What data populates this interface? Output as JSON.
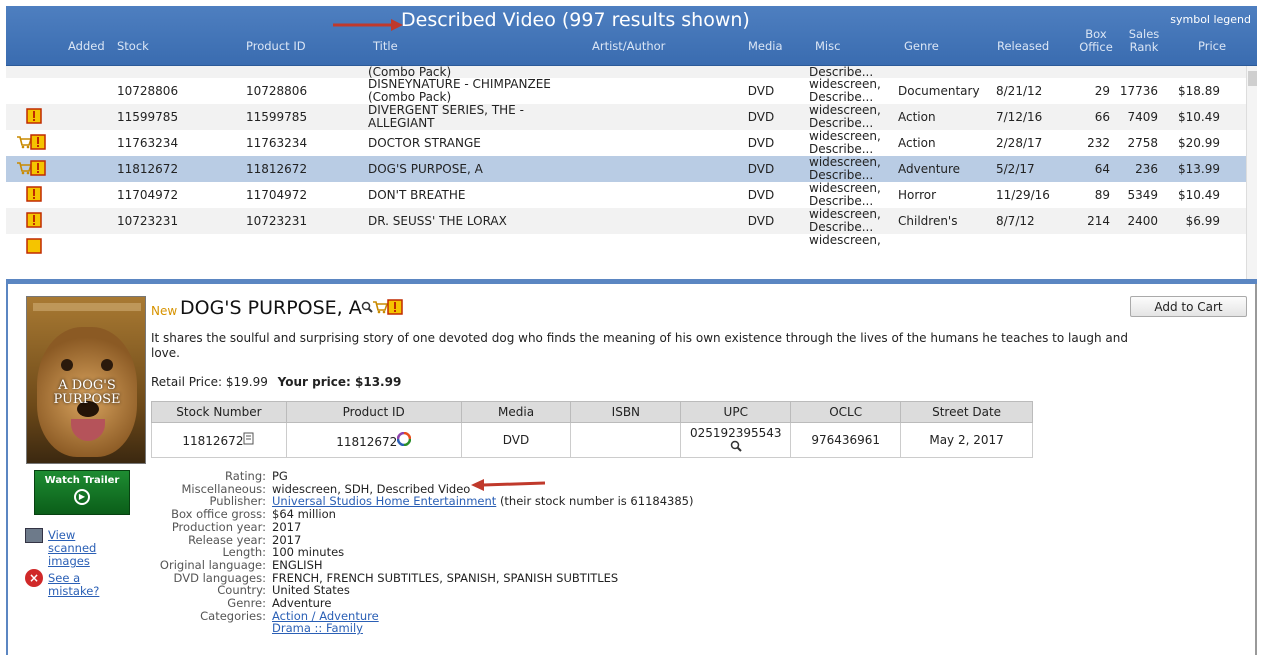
{
  "header": {
    "title": "Described Video (997 results shown)",
    "symbol_legend": "symbol legend",
    "columns": {
      "added": "Added",
      "stock": "Stock",
      "product_id": "Product ID",
      "title": "Title",
      "artist": "Artist/Author",
      "media": "Media",
      "misc": "Misc",
      "genre": "Genre",
      "released": "Released",
      "box_office_1": "Box",
      "box_office_2": "Office",
      "sales_rank_1": "Sales",
      "sales_rank_2": "Rank",
      "price": "Price"
    }
  },
  "rows": [
    {
      "stock": "10728806",
      "product_id": "10728806",
      "title_1": "DISNEYNATURE - CHIMPANZEE",
      "title_2": "(Combo Pack)",
      "media": "DVD",
      "misc_1": "widescreen,",
      "misc_2": "Describe...",
      "genre": "Documentary",
      "released": "8/21/12",
      "box_office": "29",
      "sales_rank": "17736",
      "price": "$18.89"
    },
    {
      "stock": "11599785",
      "product_id": "11599785",
      "title_1": "DIVERGENT SERIES, THE -",
      "title_2": "ALLEGIANT",
      "media": "DVD",
      "misc_1": "widescreen,",
      "misc_2": "Describe...",
      "genre": "Action",
      "released": "7/12/16",
      "box_office": "66",
      "sales_rank": "7409",
      "price": "$10.49"
    },
    {
      "stock": "11763234",
      "product_id": "11763234",
      "title_1": "DOCTOR STRANGE",
      "media": "DVD",
      "misc_1": "widescreen,",
      "misc_2": "Describe...",
      "genre": "Action",
      "released": "2/28/17",
      "box_office": "232",
      "sales_rank": "2758",
      "price": "$20.99"
    },
    {
      "stock": "11812672",
      "product_id": "11812672",
      "title_1": "DOG'S PURPOSE, A",
      "media": "DVD",
      "misc_1": "widescreen,",
      "misc_2": "Describe...",
      "genre": "Adventure",
      "released": "5/2/17",
      "box_office": "64",
      "sales_rank": "236",
      "price": "$13.99"
    },
    {
      "stock": "11704972",
      "product_id": "11704972",
      "title_1": "DON'T BREATHE",
      "media": "DVD",
      "misc_1": "widescreen,",
      "misc_2": "Describe...",
      "genre": "Horror",
      "released": "11/29/16",
      "box_office": "89",
      "sales_rank": "5349",
      "price": "$10.49"
    },
    {
      "stock": "10723231",
      "product_id": "10723231",
      "title_1": "DR. SEUSS' THE LORAX",
      "media": "DVD",
      "misc_1": "widescreen,",
      "misc_2": "Describe...",
      "genre": "Children's",
      "released": "8/7/12",
      "box_office": "214",
      "sales_rank": "2400",
      "price": "$6.99"
    }
  ],
  "partial_top_row": {
    "title_2": "(Combo Pack)",
    "misc_2": "Describe..."
  },
  "partial_bottom_row": {
    "misc_1": "widescreen,"
  },
  "detail": {
    "new_badge": "New",
    "title": "DOG'S PURPOSE, A",
    "add_to_cart": "Add to Cart",
    "description": "It shares the soulful and surprising story of one devoted dog who finds the meaning of his own existence through the lives of the humans he teaches to laugh and love.",
    "retail_price": "Retail Price: $19.99",
    "your_price": "Your price: $13.99",
    "poster_title": "A DOG'S PURPOSE",
    "trailer_label": "Watch Trailer",
    "view_scanned": "View scanned images",
    "see_mistake": "See a mistake?",
    "table": {
      "headers": [
        "Stock Number",
        "Product ID",
        "Media",
        "ISBN",
        "UPC",
        "OCLC",
        "Street Date"
      ],
      "stock": "11812672",
      "product_id": "11812672",
      "media": "DVD",
      "isbn": "",
      "upc": "025192395543",
      "oclc": "976436961",
      "street_date": "May 2, 2017"
    },
    "meta": {
      "rating_k": "Rating:",
      "rating_v": "PG",
      "misc_k": "Miscellaneous:",
      "misc_v": "widescreen, SDH, Described Video",
      "publisher_k": "Publisher:",
      "publisher_link": "Universal Studios Home Entertainment",
      "publisher_note": "(their stock number is 61184385)",
      "gross_k": "Box office gross:",
      "gross_v": "$64 million",
      "prod_year_k": "Production year:",
      "prod_year_v": "2017",
      "rel_year_k": "Release year:",
      "rel_year_v": "2017",
      "length_k": "Length:",
      "length_v": "100 minutes",
      "orig_lang_k": "Original language:",
      "orig_lang_v": "ENGLISH",
      "dvd_lang_k": "DVD languages:",
      "dvd_lang_v": "FRENCH, FRENCH SUBTITLES, SPANISH, SPANISH SUBTITLES",
      "country_k": "Country:",
      "country_v": "United States",
      "genre_k": "Genre:",
      "genre_v": "Adventure",
      "categories_k": "Categories:",
      "categories_v1": "Action / Adventure",
      "categories_v2": "Drama :: Family"
    }
  },
  "colors": {
    "header_blue": "#3f73b7",
    "selected_row": "#b9cce4",
    "alert_yellow": "#f5c400",
    "arrow_red": "#c0392b",
    "link_blue": "#2a5fb5"
  }
}
